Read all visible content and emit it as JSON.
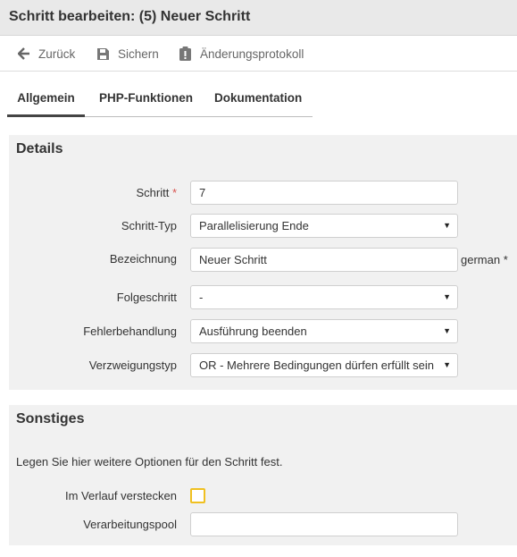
{
  "window": {
    "title": "Schritt bearbeiten: (5) Neuer Schritt"
  },
  "toolbar": {
    "back_label": "Zurück",
    "save_label": "Sichern",
    "changelog_label": "Änderungsprotokoll"
  },
  "tabs": [
    {
      "label": "Allgemein",
      "active": true
    },
    {
      "label": "PHP-Funktionen",
      "active": false
    },
    {
      "label": "Dokumentation",
      "active": false
    }
  ],
  "details": {
    "title": "Details",
    "step": {
      "label": "Schritt",
      "required_mark": "*",
      "value": "7"
    },
    "step_type": {
      "label": "Schritt-Typ",
      "value": "Parallelisierung Ende"
    },
    "name": {
      "label": "Bezeichnung",
      "value": "Neuer Schritt",
      "suffix": "german *"
    },
    "next_step": {
      "label": "Folgeschritt",
      "value": "-"
    },
    "error_handling": {
      "label": "Fehlerbehandlung",
      "value": "Ausführung beenden"
    },
    "branch_type": {
      "label": "Verzweigungstyp",
      "value": "OR - Mehrere Bedingungen dürfen erfüllt sein"
    }
  },
  "misc": {
    "title": "Sonstiges",
    "intro": "Legen Sie hier weitere Optionen für den Schritt fest.",
    "hide_in_history": {
      "label": "Im Verlauf verstecken",
      "checked": false
    },
    "processing_pool": {
      "label": "Verarbeitungspool",
      "value": ""
    }
  },
  "colors": {
    "required": "#d9534f",
    "checkbox_border": "#f0c020",
    "panel_bg": "#f1f1f1",
    "titlebar_bg": "#e9e9e9"
  }
}
